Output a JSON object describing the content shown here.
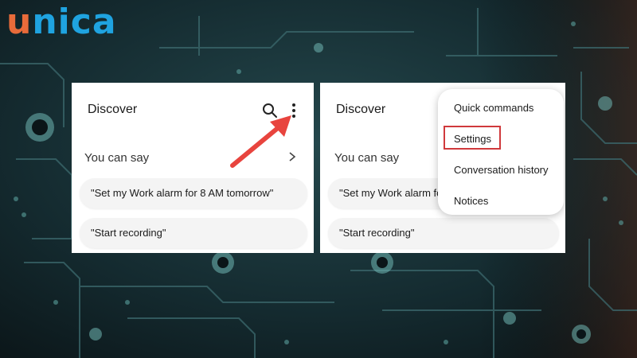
{
  "brand": {
    "logo_u": "u",
    "logo_rest": "nica"
  },
  "left_screen": {
    "title": "Discover",
    "section_label": "You can say",
    "suggestions": [
      "\"Set my Work alarm for 8 AM tomorrow\"",
      "\"Start recording\""
    ],
    "icons": [
      "search-icon",
      "more-vert-icon",
      "chevron-right-icon"
    ]
  },
  "right_screen": {
    "title": "Discover",
    "section_label": "You can say",
    "suggestions": [
      "\"Set my Work alarm for 8 AM tomorrow\"",
      "\"Start recording\""
    ],
    "menu": {
      "items": [
        "Quick commands",
        "Settings",
        "Conversation history",
        "Notices"
      ],
      "highlighted": "Settings"
    }
  },
  "colors": {
    "accent_arrow": "#e8443e",
    "highlight_border": "#d0393c",
    "logo_orange": "#e86b3a",
    "logo_blue": "#1fa3e0"
  }
}
